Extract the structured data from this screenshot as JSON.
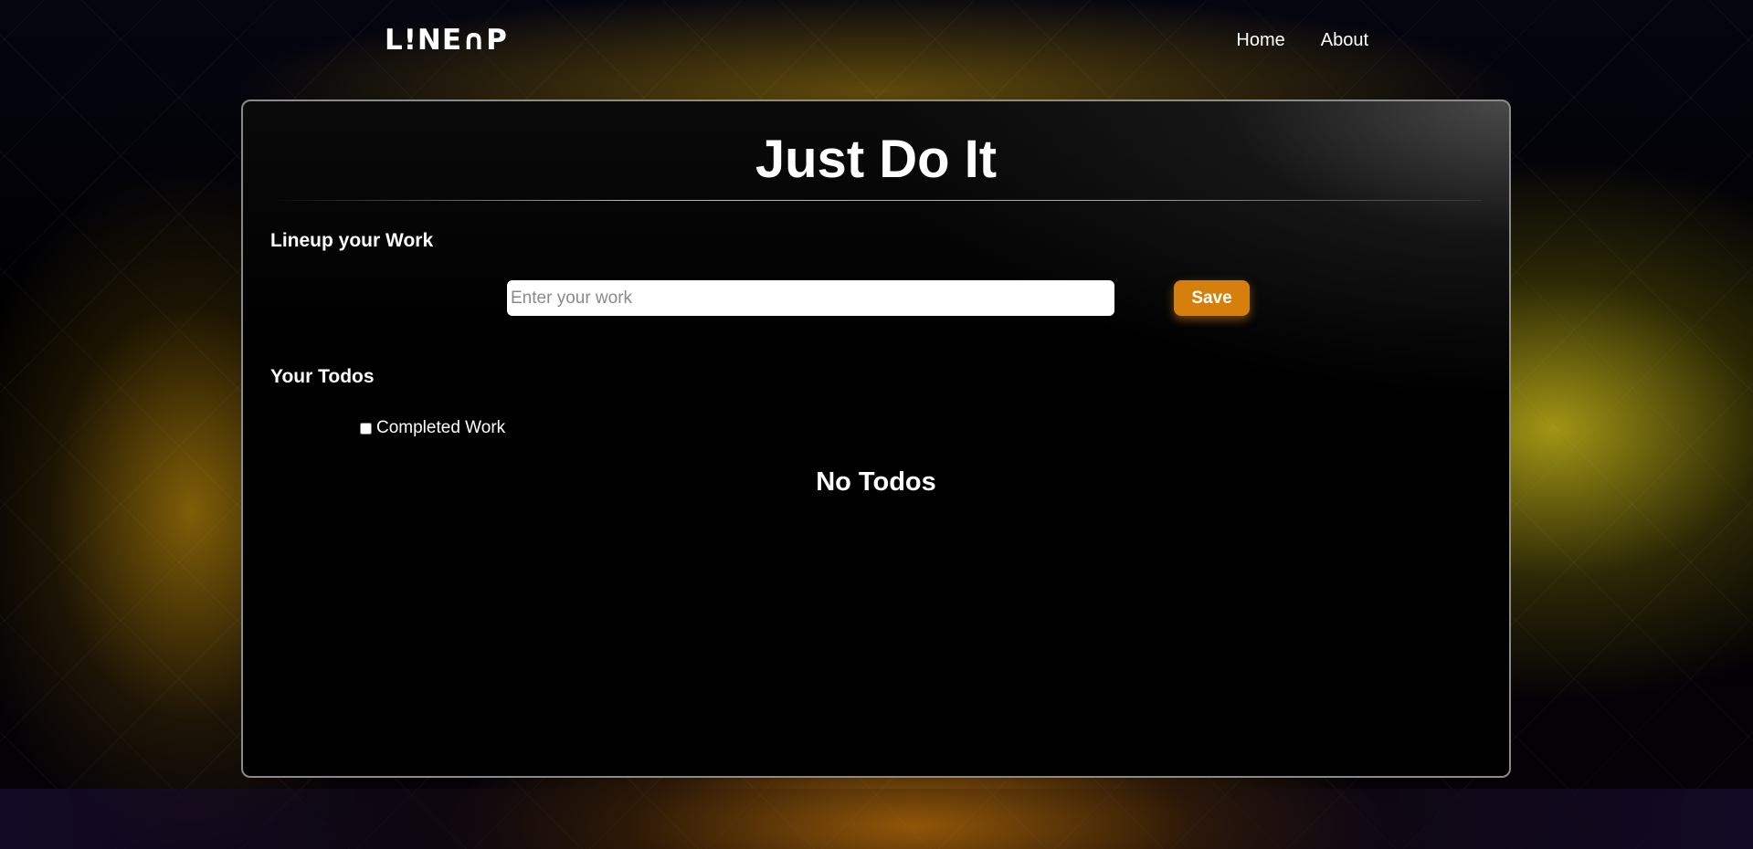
{
  "brand": {
    "logo_text": "L!NE∩P"
  },
  "nav": {
    "items": [
      {
        "label": "Home"
      },
      {
        "label": "About"
      }
    ]
  },
  "card": {
    "title": "Just Do It",
    "add_section": {
      "heading": "Lineup your Work",
      "input_value": "",
      "input_placeholder": "Enter your work",
      "save_label": "Save"
    },
    "todos_section": {
      "heading": "Your Todos",
      "completed_filter_label": "Completed Work",
      "completed_filter_checked": false,
      "empty_message": "No Todos"
    }
  },
  "colors": {
    "accent": "#d67f0c",
    "card_border": "#8a8a8a",
    "glow_yellow": "#bfae19",
    "glow_orange": "#c8780a"
  }
}
